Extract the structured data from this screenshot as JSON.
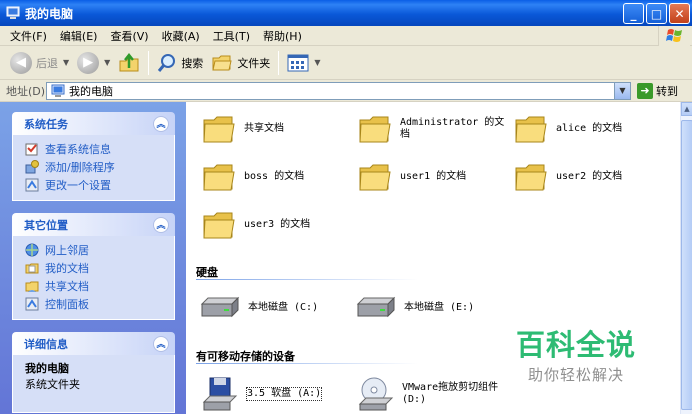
{
  "window": {
    "title": "我的电脑",
    "buttons": {
      "minimize": "_",
      "maximize": "□",
      "close": "✕"
    }
  },
  "menu": [
    "文件(F)",
    "编辑(E)",
    "查看(V)",
    "收藏(A)",
    "工具(T)",
    "帮助(H)"
  ],
  "toolbar": {
    "back": "后退",
    "search": "搜索",
    "folders": "文件夹"
  },
  "address": {
    "label": "地址(D)",
    "value": "我的电脑",
    "go": "转到"
  },
  "sidebar": {
    "system_tasks": {
      "title": "系统任务",
      "items": [
        "查看系统信息",
        "添加/删除程序",
        "更改一个设置"
      ]
    },
    "other_places": {
      "title": "其它位置",
      "items": [
        "网上邻居",
        "我的文档",
        "共享文档",
        "控制面板"
      ]
    },
    "details": {
      "title": "详细信息",
      "name": "我的电脑",
      "type": "系统文件夹"
    }
  },
  "main": {
    "folders": [
      "共享文档",
      "Administrator 的文档",
      "alice 的文档",
      "boss 的文档",
      "user1 的文档",
      "user2 的文档",
      "user3 的文档"
    ],
    "hard_disks_label": "硬盘",
    "disks": [
      "本地磁盘 (C:)",
      "本地磁盘 (E:)"
    ],
    "removable_label": "有可移动存储的设备",
    "removable": [
      "3.5 软盘 (A:)",
      "VMware拖放剪切组件 (D:)"
    ]
  },
  "watermark": {
    "main": "百科全说",
    "sub": "助你轻松解决"
  },
  "colors": {
    "title_bar": "#0a58d8",
    "task_pane": "#7ba2e7",
    "link": "#215dc6",
    "watermark": "#2dbb73"
  }
}
